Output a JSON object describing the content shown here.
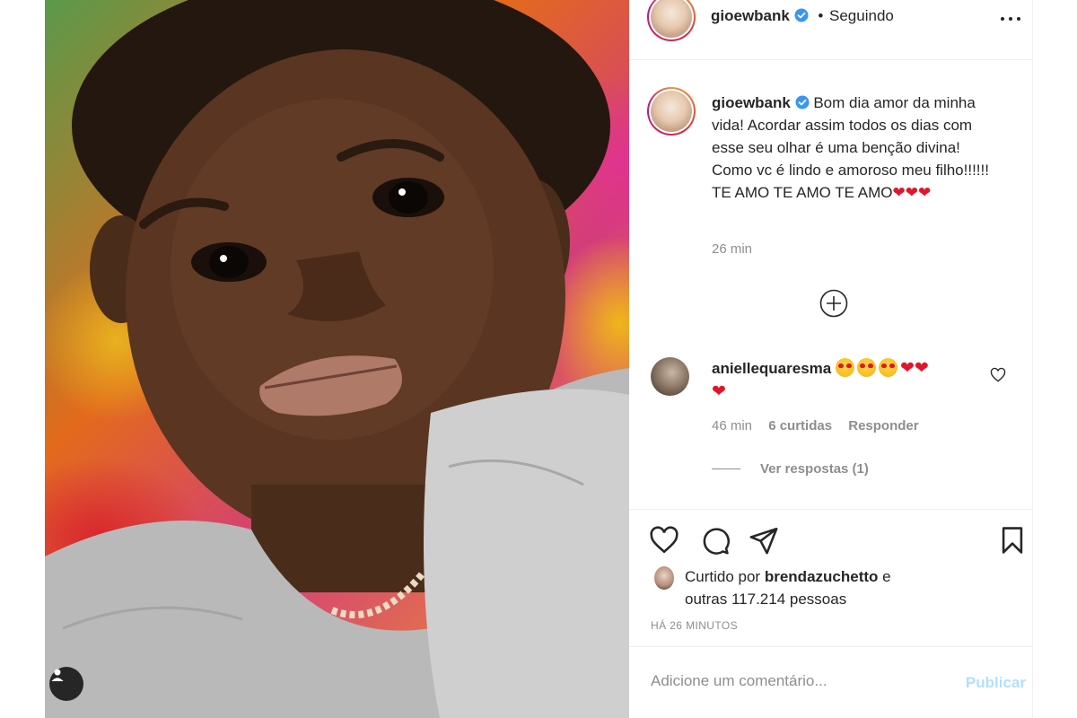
{
  "header": {
    "username": "gioewbank",
    "separator": "•",
    "follow_status": "Seguindo"
  },
  "caption": {
    "username": "gioewbank",
    "text": "Bom dia amor da minha vida! Acordar assim todos os dias com esse seu olhar é uma benção divina! Como vc é lindo e amoroso meu filho!!!!!! TE AMO TE AMO TE AMO",
    "hearts": "❤❤❤",
    "time": "26 min"
  },
  "comment": {
    "username": "aniellequaresma",
    "hearts": "❤❤",
    "hearts_line2": "❤",
    "time": "46 min",
    "likes": "6 curtidas",
    "reply": "Responder",
    "view_replies": "Ver respostas (1)"
  },
  "likes": {
    "prefix": "Curtido por",
    "user": "brendazuchetto",
    "connector": "e",
    "others": "outras 117.214 pessoas",
    "posted_ago": "HÁ 26 MINUTOS"
  },
  "add_comment": {
    "placeholder": "Adicione um comentário...",
    "publish": "Publicar"
  },
  "colors": {
    "text": "#262626",
    "muted": "#8e8e8e",
    "verified": "#3897f0",
    "heart": "#e0162b",
    "publish_disabled": "#b2dffc"
  },
  "icons": [
    "verified-icon",
    "more-options-icon",
    "load-more-icon",
    "heart-icon",
    "comment-icon",
    "share-icon",
    "bookmark-icon",
    "user-icon"
  ]
}
